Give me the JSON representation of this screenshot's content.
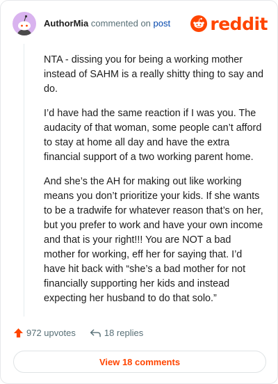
{
  "header": {
    "author": "AuthorMia",
    "commented_on": "commented on",
    "post_link": "post",
    "brand": "reddit"
  },
  "comment": {
    "paragraphs": [
      "NTA - dissing you for being a working mother instead of SAHM is a really shitty thing to say and do.",
      "I’d have had the same reaction if I was you. The audacity of that woman, some people can’t afford to stay at home all day and have the extra financial support of a two working parent home.",
      "And she’s the AH for making out like working means you don’t prioritize your kids. If she wants to be a tradwife for whatever reason that’s on her, but you prefer to work and have your own income and that is your right!!! You are NOT a bad mother for working, eff her for saying that. I’d have hit back with “she’s a bad mother for not financially supporting her kids and instead expecting her husband to do that solo.”"
    ]
  },
  "actions": {
    "upvotes": "972 upvotes",
    "replies": "18 replies"
  },
  "view_button": "View 18 comments",
  "colors": {
    "brand": "#ff4500",
    "link": "#0045ac",
    "muted": "#576f76",
    "avatar_bg": "#d9b3ef"
  },
  "icons": {
    "avatar": "snoo-avatar-icon",
    "logo": "reddit-logo-icon",
    "upvote": "upvote-arrow-icon",
    "reply": "reply-arrow-icon"
  }
}
